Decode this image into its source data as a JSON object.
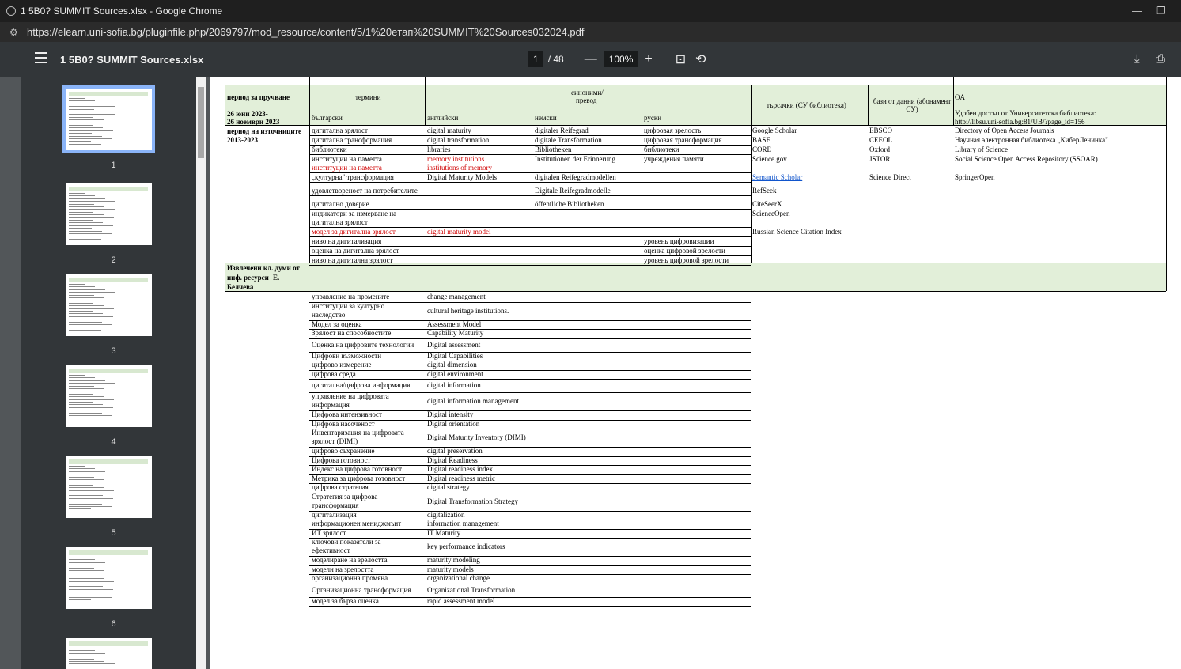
{
  "window": {
    "title": "1 5B0? SUMMIT Sources.xlsx - Google Chrome",
    "url": "https://elearn.uni-sofia.bg/pluginfile.php/2069797/mod_resource/content/5/1%20eтап%20SUMMIT%20Sources032024.pdf"
  },
  "toolbar": {
    "doc_title": "1 5B0? SUMMIT Sources.xlsx",
    "page_current": "1",
    "page_total": "/ 48",
    "zoom": "100%"
  },
  "thumbnails": [
    "1",
    "2",
    "3",
    "4",
    "5",
    "6"
  ],
  "headers": {
    "period": "период за пручване",
    "terms": "термини",
    "synonyms1": "синоними/",
    "synonyms2": "превод",
    "search": "търсачки (СУ библиотека)",
    "db": "бази от данни (абонамент СУ)",
    "oa": "OA",
    "bg": "български",
    "en": "английски",
    "de": "немски",
    "ru": "руски",
    "date1": "26 юни 2023-",
    "date2": "26 ноември 2023",
    "oa_note1": "Удобен достъп от Университетска библиотека:",
    "oa_note2": "http://libsu.uni-sofia.bg:81/UB/?page_id=156",
    "src_period": "период на източниците",
    "years": "2013-2023",
    "section1": "Извлечени кл. думи от",
    "section2": "инф. ресурси- Е.",
    "section3": "Белчева"
  },
  "rows_top": [
    {
      "bg": "дигитална зрялост",
      "en": "digital maturity",
      "de": "digitaler Reifegrad",
      "ru": "цифровая зрелость",
      "se": "Google Scholar",
      "db": "EBSCO",
      "oa": "Directory of Open Access Journals"
    },
    {
      "bg": "дигитална трансформация",
      "en": "digital transformation",
      "de": "digitale Transformation",
      "ru": "цифровая трансформация",
      "se": "BASE",
      "db": "CEEOL",
      "oa": "Научная электронная библиотека „КиберЛенинка\""
    },
    {
      "bg": "библиотеки",
      "en": "libraries",
      "de": "Bibliotheken",
      "ru": "библиотеки",
      "se": "CORE",
      "db": "Oxford",
      "oa": "Library of Science"
    },
    {
      "bg": "институции на паметта",
      "en": "memory institutions",
      "de": "Institutionen der Erinnerung",
      "ru": "учреждения памяти",
      "se": "Science.gov",
      "db": "JSTOR",
      "oa": "Social Science Open Access Repository (SSOAR)"
    },
    {
      "bg": "институции на паметта",
      "en": "institutions of memory",
      "de": "",
      "ru": "",
      "se": "",
      "db": "",
      "oa": ""
    },
    {
      "bg": "„културна\" трансформация",
      "en": "Digital Maturity Models",
      "de": "digitalen Reifegradmodellen",
      "ru": "",
      "se": "Semantic Scholar",
      "db": "Science Direct",
      "oa": "SpringerOpen"
    },
    {
      "bg": "удовлетвореност на потребителите",
      "en": "",
      "de": "Digitale Reifegradmodelle",
      "ru": "",
      "se": "RefSeek",
      "db": "",
      "oa": ""
    },
    {
      "bg": "дигитално доверие",
      "en": "",
      "de": "öffentliche Bibliotheken",
      "ru": "",
      "se": "CiteSeerX",
      "db": "",
      "oa": ""
    },
    {
      "bg": "индикатори за измерване на",
      "bg2": "дигитална зрялост",
      "en": "",
      "de": "",
      "ru": "",
      "se": "ScienceOpen",
      "db": "",
      "oa": ""
    },
    {
      "bg": "модел за дигитална зрялост",
      "en": "digital maturity model",
      "de": "",
      "ru": "",
      "se": "Russian Science Citation Index",
      "db": "",
      "oa": ""
    },
    {
      "bg": "ниво на дигитализация",
      "en": "",
      "de": "",
      "ru": "уровень цифровизации",
      "se": "",
      "db": "",
      "oa": ""
    },
    {
      "bg": "оценка на дигитална зрялост",
      "en": "",
      "de": "",
      "ru": "оценка цифровой зрелости",
      "se": "",
      "db": "",
      "oa": ""
    },
    {
      "bg": "ниво на дигитална зрялост",
      "en": "",
      "de": "",
      "ru": "уровень цифровой зрелости",
      "se": "",
      "db": "",
      "oa": ""
    }
  ],
  "rows_bottom": [
    {
      "bg": "управление на промените",
      "en": "change management"
    },
    {
      "bg": "институции за културно",
      "bg2": "наследство",
      "en": "cultural heritage institutions."
    },
    {
      "bg": "Модел за оценка",
      "en": "Assessment Model"
    },
    {
      "bg": "Зрялост на способностите",
      "en": "Capability Maturity"
    },
    {
      "bg": "Оценка на цифровите технологии",
      "en": "Digital assessment"
    },
    {
      "bg": "Цифрови възможности",
      "en": "Digital Capabilities"
    },
    {
      "bg": "цифрово измерение",
      "en": "digital dimension"
    },
    {
      "bg": "цифрова среда",
      "en": "digital environment"
    },
    {
      "bg": "дигитална/цифрова информация",
      "en": "digital information"
    },
    {
      "bg": "управление на цифровата",
      "bg2": "информация",
      "en": "digital information management"
    },
    {
      "bg": "Цифрова интензивност",
      "en": "Digital intensity"
    },
    {
      "bg": "Цифрова насоченост",
      "en": "Digital orientation"
    },
    {
      "bg": "Инвентаризация на цифровата",
      "bg2": "зрялост (DIMI)",
      "en": "Digital Maturity Inventory (DIMI)"
    },
    {
      "bg": "цифрово съхранение",
      "en": "digital preservation"
    },
    {
      "bg": "Цифрова готовност",
      "en": "Digital Readiness"
    },
    {
      "bg": "Индекс на цифрова готовност",
      "en": "Digital readiness index"
    },
    {
      "bg": "Метрика за цифрова готовност",
      "en": "Digital readiness metric"
    },
    {
      "bg": "цифрова стратегия",
      "en": "digital strategy"
    },
    {
      "bg": "Стратегия за цифрова",
      "bg2": "трансформация",
      "en": "Digital Transformation Strategy"
    },
    {
      "bg": "дигитализация",
      "en": "digitalization"
    },
    {
      "bg": "информационен мениджмънт",
      "en": "information management"
    },
    {
      "bg": "ИТ зрялост",
      "en": "IT Maturity"
    },
    {
      "bg": "ключови показатели за",
      "bg2": "ефективност",
      "en": "key performance indicators"
    },
    {
      "bg": "моделиране на зрелостта",
      "en": "maturity modeling"
    },
    {
      "bg": "модели на зрелостта",
      "en": "maturity models"
    },
    {
      "bg": "организационна промяна",
      "en": "organizational change"
    },
    {
      "bg": "Организационна трансформация",
      "en": "Organizational Transformation"
    },
    {
      "bg": "модел за бърза оценка",
      "en": "rapid assessment model"
    }
  ]
}
